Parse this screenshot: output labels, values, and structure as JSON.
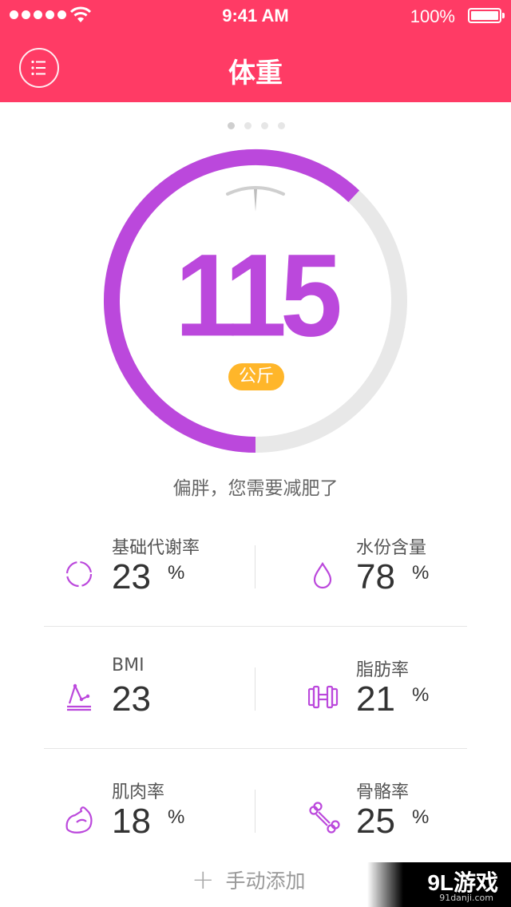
{
  "status_bar": {
    "time": "9:41 AM",
    "battery": "100%"
  },
  "header": {
    "title": "体重"
  },
  "weight": {
    "value": "115",
    "unit": "公斤",
    "status": "偏胖，您需要减肥了",
    "progress": 0.62
  },
  "colors": {
    "header": "#ff3b65",
    "accent": "#bb48dc",
    "badge": "#ffb62a"
  },
  "metrics": [
    {
      "label": "基础代谢率",
      "value": "23",
      "unit": "%",
      "icon": "metabolism-icon"
    },
    {
      "label": "水份含量",
      "value": "78",
      "unit": "%",
      "icon": "water-drop-icon"
    },
    {
      "label": "BMI",
      "value": "23",
      "unit": "",
      "icon": "bmi-chart-icon"
    },
    {
      "label": "脂肪率",
      "value": "21",
      "unit": "%",
      "icon": "dumbbell-icon"
    },
    {
      "label": "肌肉率",
      "value": "18",
      "unit": "%",
      "icon": "muscle-arm-icon"
    },
    {
      "label": "骨骼率",
      "value": "25",
      "unit": "%",
      "icon": "bone-icon"
    }
  ],
  "add_manual": {
    "label": "手动添加"
  },
  "watermark": {
    "main": "9L游戏",
    "sub": "91danji.com"
  }
}
